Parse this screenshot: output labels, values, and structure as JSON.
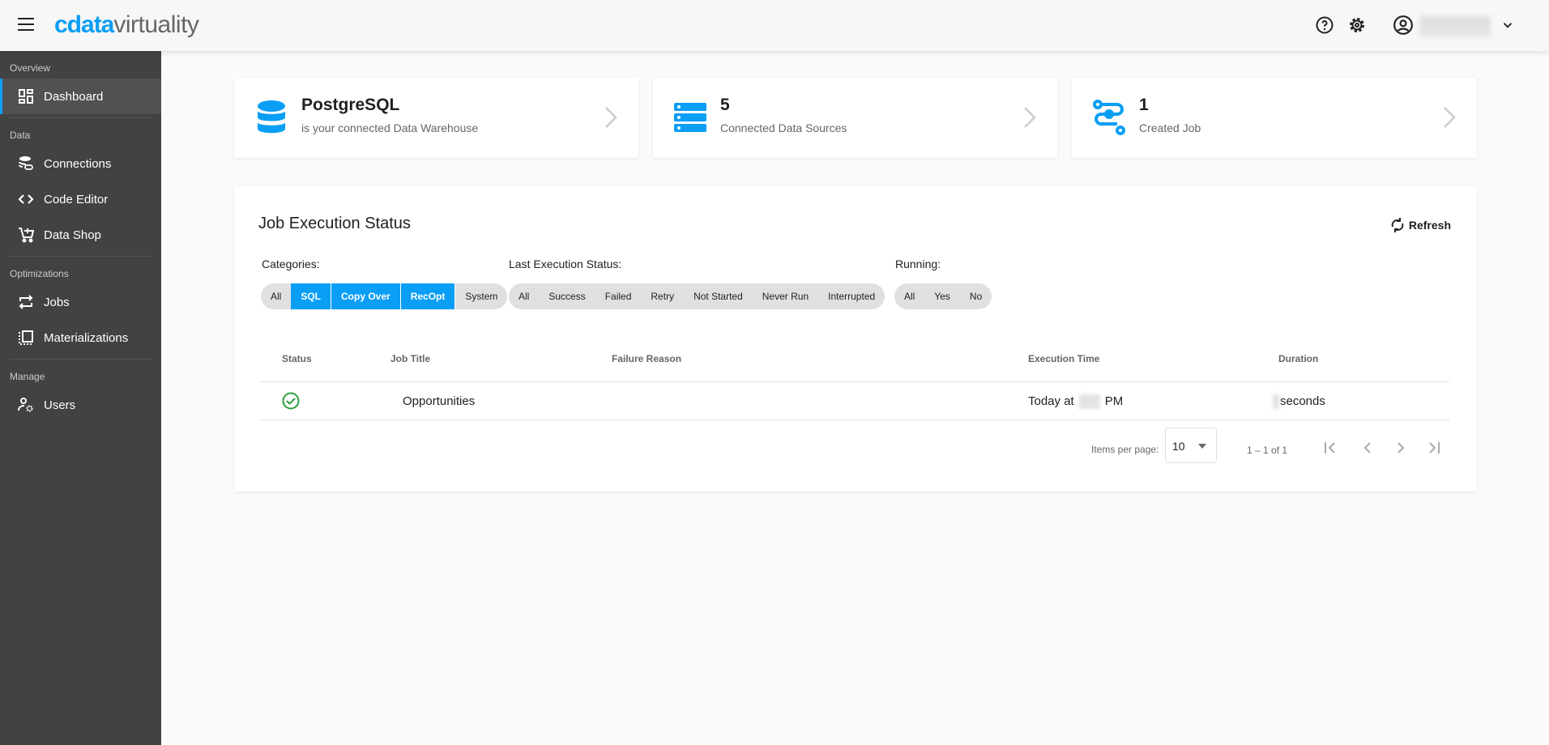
{
  "header": {
    "logo_brand": "cdata",
    "logo_product": "virtuality"
  },
  "sidebar": {
    "sections": [
      {
        "title": "Overview",
        "items": [
          {
            "label": "Dashboard"
          }
        ]
      },
      {
        "title": "Data",
        "items": [
          {
            "label": "Connections"
          },
          {
            "label": "Code Editor"
          },
          {
            "label": "Data Shop"
          }
        ]
      },
      {
        "title": "Optimizations",
        "items": [
          {
            "label": "Jobs"
          },
          {
            "label": "Materializations"
          }
        ]
      },
      {
        "title": "Manage",
        "items": [
          {
            "label": "Users"
          }
        ]
      }
    ]
  },
  "cards": [
    {
      "title": "PostgreSQL",
      "subtitle": "is your connected Data Warehouse"
    },
    {
      "title": "5",
      "subtitle": "Connected Data Sources"
    },
    {
      "title": "1",
      "subtitle": "Created Job"
    }
  ],
  "panel": {
    "title": "Job Execution Status",
    "refresh": "Refresh",
    "filters": {
      "categories": {
        "label": "Categories:",
        "options": [
          "All",
          "SQL",
          "Copy Over",
          "RecOpt",
          "System"
        ]
      },
      "status": {
        "label": "Last Execution Status:",
        "options": [
          "All",
          "Success",
          "Failed",
          "Retry",
          "Not Started",
          "Never Run",
          "Interrupted"
        ]
      },
      "running": {
        "label": "Running:",
        "options": [
          "All",
          "Yes",
          "No"
        ]
      }
    },
    "columns": [
      "Status",
      "Job Title",
      "Failure Reason",
      "Execution Time",
      "Duration"
    ],
    "rows": [
      {
        "status": "success",
        "job_title": "Opportunities",
        "failure_reason": "",
        "execution_prefix": "Today at",
        "execution_suffix": "PM",
        "duration_suffix": "seconds"
      }
    ],
    "pagination": {
      "items_per_page_label": "Items per page:",
      "items_per_page": "10",
      "range": "1 – 1 of 1"
    }
  },
  "colors": {
    "accent": "#0a9ef5",
    "sidebar": "#424242",
    "success": "#2e9e3e"
  }
}
